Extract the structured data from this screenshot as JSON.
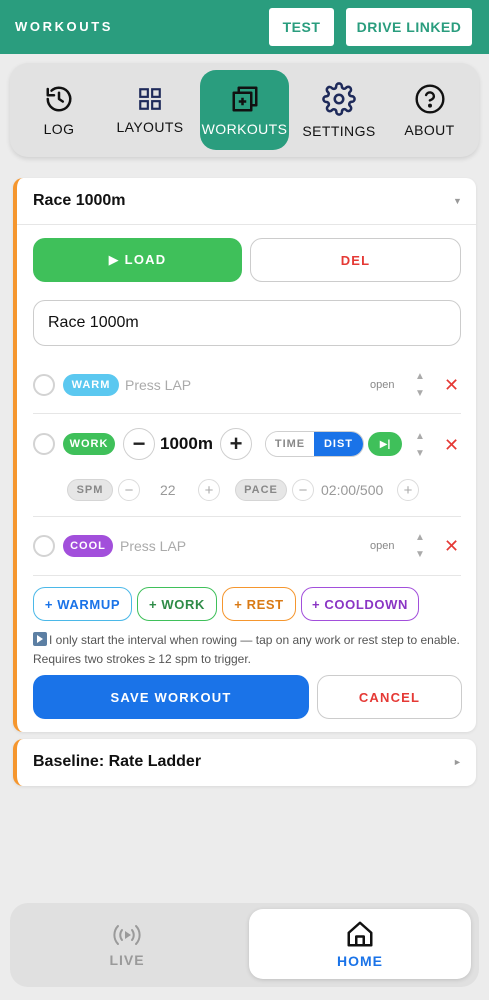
{
  "app": {
    "title": "WORKOUTS"
  },
  "header": {
    "test_label": "TEST",
    "drive_label": "DRIVE LINKED"
  },
  "nav": {
    "items": [
      {
        "label": "LOG",
        "icon": "history-icon"
      },
      {
        "label": "LAYOUTS",
        "icon": "grid-icon"
      },
      {
        "label": "WORKOUTS",
        "icon": "stack-add-icon",
        "active": true
      },
      {
        "label": "SETTINGS",
        "icon": "gear-icon"
      },
      {
        "label": "ABOUT",
        "icon": "help-icon"
      }
    ]
  },
  "workout": {
    "title": "Race 1000m",
    "load_label": "▶ LOAD",
    "del_label": "DEL",
    "name_value": "Race 1000m",
    "steps": {
      "warm": {
        "tag": "WARM",
        "placeholder": "Press LAP",
        "mode": "open"
      },
      "work": {
        "tag": "WORK",
        "distance": "1000m",
        "minus": "−",
        "plus": "+",
        "seg_time": "TIME",
        "seg_dist": "DIST",
        "seg_active": "DIST",
        "play": "▶|",
        "spm_label": "SPM",
        "spm_value": "22",
        "pace_label": "PACE",
        "pace_value": "02:00/500"
      },
      "cool": {
        "tag": "COOL",
        "placeholder": "Press LAP",
        "mode": "open"
      }
    },
    "add_buttons": {
      "warmup": "+ WARMUP",
      "work": "+ WORK",
      "rest": "+ REST",
      "cooldown": "+ COOLDOWN"
    },
    "note": "I only start the interval when rowing — tap on any work or rest step to enable. Requires two strokes ≥ 12 spm to trigger.",
    "save_label": "SAVE WORKOUT",
    "cancel_label": "CANCEL"
  },
  "second_workout": {
    "title": "Baseline: Rate Ladder"
  },
  "bottom_nav": {
    "live_label": "LIVE",
    "home_label": "HOME",
    "active": "HOME"
  },
  "colors": {
    "primary_teal": "#2a9d7e",
    "accent_blue": "#1a73e8",
    "load_green": "#3fc05a",
    "danger_red": "#e53935",
    "card_accent_orange": "#f5962e",
    "warm_tag": "#5bc8f0",
    "work_tag": "#3fc05a",
    "cool_tag": "#a24fdb"
  }
}
